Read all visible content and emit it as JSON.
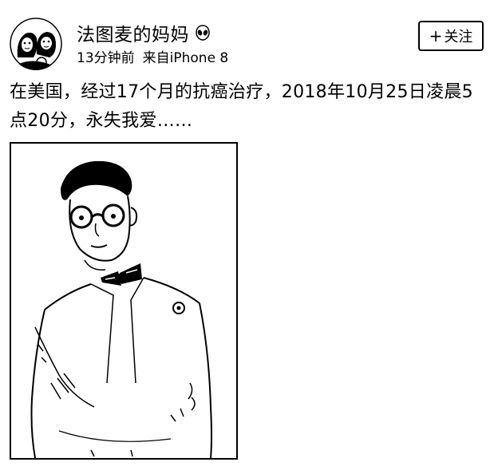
{
  "post": {
    "username": "法图麦的妈妈",
    "badge_icon": "alien-emoji-icon",
    "time": "13分钟前",
    "source": "来自iPhone 8",
    "follow_label": "关注",
    "follow_icon": "plus-icon",
    "text": "在美国，经过17个月的抗癌治疗，2018年10月25日凌晨5点20分，永失我爱……"
  }
}
